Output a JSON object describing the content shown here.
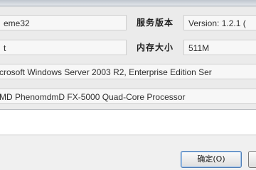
{
  "fields": {
    "theme_value": "eme32",
    "service_pack_label": "服务版本",
    "service_pack_value": "Version: 1.2.1 (",
    "row2_value": "t",
    "memory_label": "内存大小",
    "memory_value": "511M",
    "os_value": "crosoft Windows Server 2003 R2, Enterprise Edition Ser",
    "cpu_value": "MD PhenomdmD FX-5000 Quad-Core Processor"
  },
  "buttons": {
    "ok_label": "确定(O)",
    "partial_label": ""
  }
}
